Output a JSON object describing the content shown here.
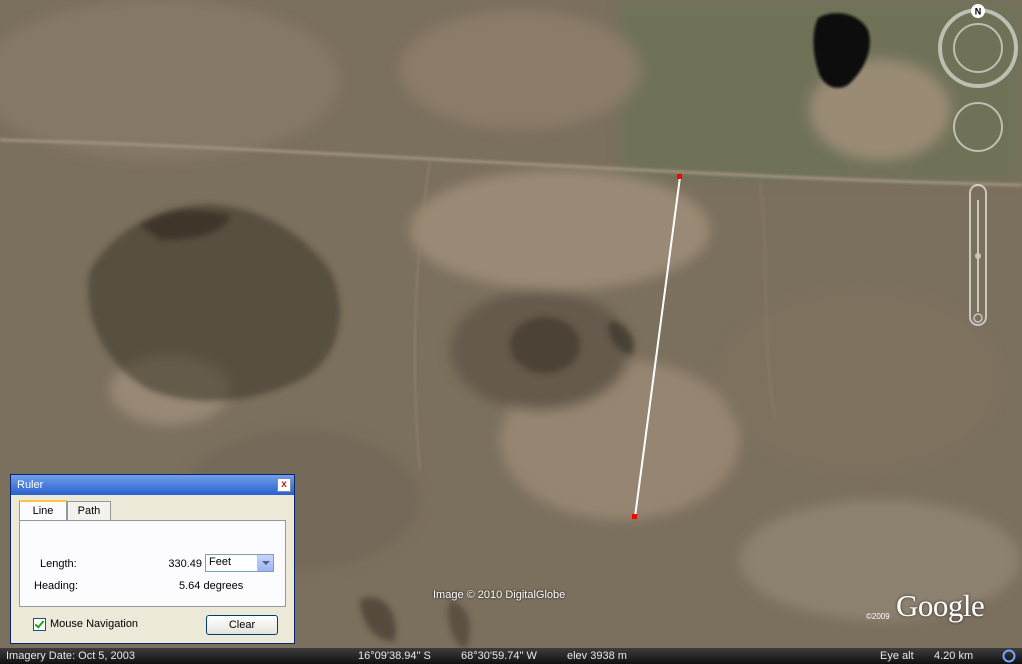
{
  "map": {
    "imagery_credit": "Image © 2010 DigitalGlobe",
    "google_copyright_year": "©2009",
    "google_logo": "Google",
    "compass_label": "N",
    "icons": [
      "look-joystick-icon",
      "move-joystick-icon",
      "zoom-slider-icon"
    ]
  },
  "ruler": {
    "title": "Ruler",
    "close_label": "x",
    "tabs": [
      {
        "label": "Line",
        "active": true
      },
      {
        "label": "Path",
        "active": false
      }
    ],
    "length_label": "Length:",
    "length_value": "330.49",
    "unit_selected": "Feet",
    "heading_label": "Heading:",
    "heading_value": "5.64 degrees",
    "mouse_navigation_label": "Mouse Navigation",
    "mouse_navigation_checked": true,
    "clear_label": "Clear"
  },
  "status_bar": {
    "imagery_date": "Imagery Date: Oct  5, 2003",
    "latitude": "16°09'38.94\" S",
    "longitude": "68°30'59.74\" W",
    "elevation": "elev 3938 m",
    "eye_alt_label": "Eye alt",
    "eye_alt_value": "4.20 km"
  },
  "colors": {
    "terrain": "#7a6e5c",
    "ruler_line": "#ffffff",
    "ruler_endpoint": "#ff0000",
    "title_bar": "#2a5fcf"
  }
}
